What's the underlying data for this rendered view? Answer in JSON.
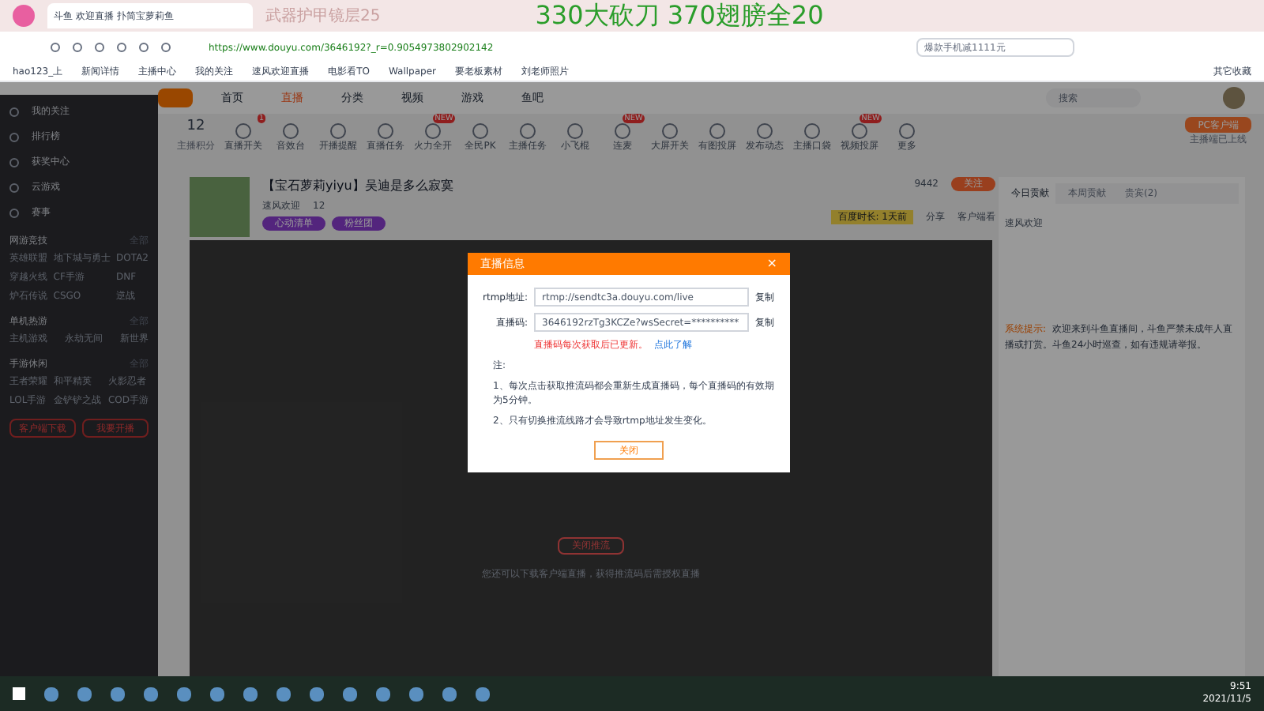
{
  "browser": {
    "tab_title": "斗鱼 欢迎直播 扑简宝萝莉鱼",
    "overlay_texts": [
      "武器护甲镜层25",
      "330大砍刀 370翅膀全20"
    ],
    "url": "https://www.douyu.com/3646192?_r=0.9054973802902142",
    "search_placeholder": "爆款手机减1111元",
    "bookmarks": [
      "hao123_上",
      "新闻详情",
      "主播中心",
      "我的关注",
      "速风欢迎直播",
      "电影看TO",
      "Wallpaper",
      "要老板素材",
      "刘老师照片"
    ],
    "other_bookmarks": "其它收藏"
  },
  "site_nav": {
    "items": [
      {
        "label": "首页",
        "selected": false
      },
      {
        "label": "直播",
        "selected": true
      },
      {
        "label": "分类",
        "selected": false
      },
      {
        "label": "视频",
        "selected": false
      },
      {
        "label": "游戏",
        "selected": false
      },
      {
        "label": "鱼吧",
        "selected": false
      }
    ],
    "search_placeholder": "搜索"
  },
  "sidebar": {
    "items": [
      "我的关注",
      "排行榜",
      "获奖中心",
      "云游戏",
      "赛事"
    ],
    "sections": [
      {
        "title": "网游竞技",
        "more": "全部",
        "games": [
          "英雄联盟",
          "地下城与勇士",
          "DOTA2",
          "穿越火线",
          "CF手游",
          "DNF",
          "炉石传说",
          "CSGO",
          "逆战"
        ]
      },
      {
        "title": "单机热游",
        "more": "全部",
        "games": [
          "主机游戏",
          "永劫无间",
          "新世界"
        ]
      },
      {
        "title": "手游休闲",
        "more": "全部",
        "games": [
          "王者荣耀",
          "和平精英",
          "火影忍者",
          "LOL手游",
          "金铲铲之战",
          "COD手游"
        ]
      }
    ],
    "buttons": [
      "客户端下载",
      "我要开播"
    ]
  },
  "toolbar": {
    "score": "12",
    "score_label": "主播积分",
    "items": [
      {
        "label": "直播开关",
        "badge": "1"
      },
      {
        "label": "音效台"
      },
      {
        "label": "开播提醒"
      },
      {
        "label": "直播任务"
      },
      {
        "label": "火力全开",
        "badge": "NEW"
      },
      {
        "label": "全民PK"
      },
      {
        "label": "主播任务"
      },
      {
        "label": "小飞棍"
      },
      {
        "label": "连麦",
        "badge": "NEW"
      },
      {
        "label": "大屏开关"
      },
      {
        "label": "有图投屏"
      },
      {
        "label": "发布动态"
      },
      {
        "label": "主播口袋"
      },
      {
        "label": "视频投屏",
        "badge": "NEW"
      },
      {
        "label": "更多"
      }
    ],
    "pc_client": "PC客户端",
    "pc_client_note": "主播端已上线"
  },
  "room": {
    "title": "【宝石萝莉yiyu】吴迪是多么寂寞",
    "followers": "9442",
    "follow": "关注",
    "anchor": "速风欢迎",
    "heat": "12",
    "badges": [
      "心动清单",
      "粉丝团"
    ],
    "online_time": "百度时长: 1天前",
    "share": "分享",
    "client_watch": "客户端看"
  },
  "modal": {
    "title": "直播信息",
    "close": "×",
    "fields": [
      {
        "label": "rtmp地址:",
        "value": "rtmp://sendtc3a.douyu.com/live",
        "copy": "复制"
      },
      {
        "label": "直播码:",
        "value": "3646192rzTg3KCZe?wsSecret=**********",
        "copy": "复制"
      }
    ],
    "warning": "直播码每次获取后已更新。",
    "learn_more": "点此了解",
    "note_title": "注:",
    "notes": [
      "1、每次点击获取推流码都会重新生成直播码，每个直播码的有效期为5分钟。",
      "2、只有切换推流线路才会导致rtmp地址发生变化。"
    ],
    "button": "关闭"
  },
  "player": {
    "button": "关闭推流",
    "hint": "您还可以下载客户端直播，获得推流码后需授权直播"
  },
  "right_panel": {
    "tabs": [
      {
        "label": "今日贡献",
        "selected": true
      },
      {
        "label": "本周贡献",
        "selected": false
      },
      {
        "label": "贵宾(2)",
        "selected": false
      }
    ],
    "anchor": "速风欢迎",
    "notice_label": "系统提示:",
    "notice": "欢迎来到斗鱼直播间，斗鱼严禁未成年人直播或打赏。斗鱼24小时巡查，如有违规请举报。"
  },
  "taskbar": {
    "time": "9:51",
    "date": "2021/11/5"
  }
}
